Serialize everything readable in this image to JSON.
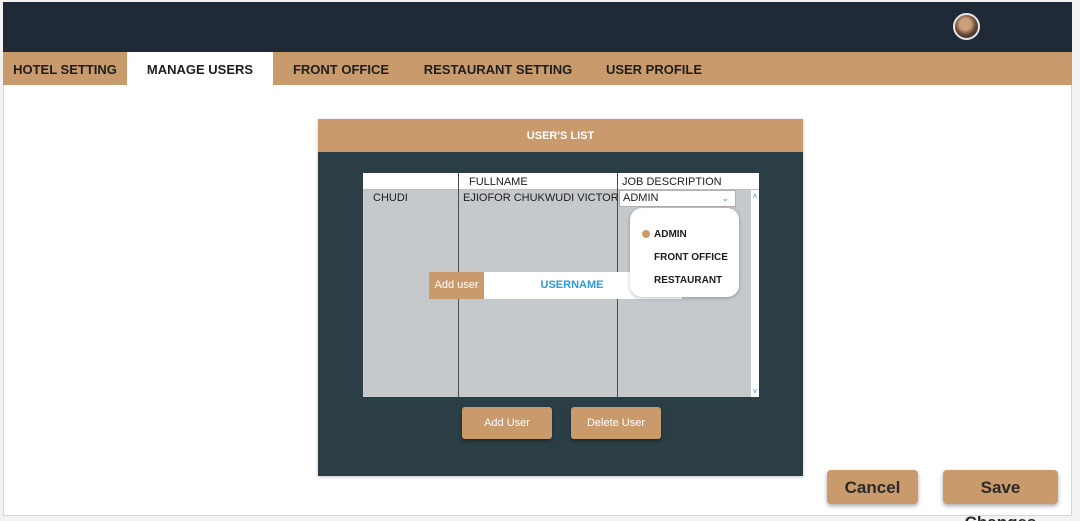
{
  "colors": {
    "topbar": "#1f2a36",
    "accent": "#c99a6b",
    "panel": "#2b3d45",
    "table": "#c5c9cc",
    "link_blue": "#2e9ad6"
  },
  "header": {
    "avatar_icon": "user-avatar"
  },
  "nav": {
    "tabs": [
      {
        "label": "HOTEL SETTING",
        "active": false
      },
      {
        "label": "MANAGE USERS",
        "active": true
      },
      {
        "label": "FRONT OFFICE",
        "active": false
      },
      {
        "label": "RESTAURANT SETTING",
        "active": false
      },
      {
        "label": "USER PROFILE",
        "active": false
      }
    ]
  },
  "users_panel": {
    "title": "USER'S LIST",
    "columns": [
      "",
      "FULLNAME",
      "JOB DESCRIPTION"
    ],
    "rows": [
      {
        "username": "CHUDI",
        "fullname": "EJIOFOR CHUKWUDI VICTOR",
        "job": "ADMIN"
      }
    ],
    "job_dropdown": {
      "selected": "ADMIN",
      "options": [
        "ADMIN",
        "FRONT OFFICE",
        "RESTAURANT"
      ]
    },
    "add_user_tag": "Add user",
    "username_field": "USERNAME",
    "add_user_button": "Add User",
    "delete_user_button": "Delete User"
  },
  "footer": {
    "cancel_label": "Cancel",
    "save_label": "Save Changes"
  }
}
